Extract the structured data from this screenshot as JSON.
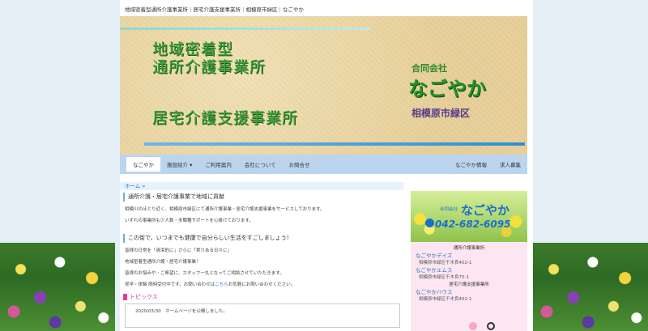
{
  "topbar": {
    "title": "地域密着型通所介護事業所｜居宅介護支援事業所｜相模原市緑区｜なごやか"
  },
  "hero": {
    "heading_line1": "地域密着型",
    "heading_line2": "通所介護事業所",
    "heading_line3": "居宅介護支援事業所",
    "company_type": "合同会社",
    "company_name": "なごやか",
    "area": "相模原市緑区"
  },
  "nav": {
    "items": [
      "なごやか",
      "施設紹介 ▾",
      "ご利用案内",
      "会社について",
      "お問合せ"
    ],
    "right_items": [
      "なごやか情報",
      "求人募集"
    ]
  },
  "breadcrumb": {
    "home": "ホーム »"
  },
  "main": {
    "section1_heading": "通所介護・居宅介護事業で地域に貢献",
    "section1_p1": "相模川のほとり近く、相模原市緑区にて通所介護事業・居宅介護支援事業をサービスしております。",
    "section1_p2": "いずれの事業所も少人数・多職種サポートを心掛けております。",
    "section2_heading": "この街で、いつまでも健康で自分らしい生活をすごしましょう！",
    "section2_p1": "皆様の日常を「清潔的に」さらに「実りある日々に」",
    "section2_p2": "地域密着型通所介護・居宅介護事業！",
    "section2_p3": "皆様のお悩みや・ご希望に、スタッフ一丸となってご相談させていただきます。",
    "section2_p4_prefix": "見学・体験 随時受付中です。お問い合わせは",
    "section2_p4_link": "こちら",
    "section2_p4_suffix": "お気軽にお問い合わせください。",
    "topics_heading": "トピックス",
    "topics_first": "2020/03/30　ホームページを公開しました。"
  },
  "sidebar": {
    "banner_company_type": "合同会社",
    "banner_company_name": "なごやか",
    "banner_phone": "042-682-6095",
    "cat1": "通所介護事業所",
    "office1_name": "なごやかデイズ",
    "office1_addr": "相模原市緑区千木良402-1",
    "office2_name": "なごやかエムス",
    "office2_addr": "相模原市緑区千木良75-1",
    "cat2": "居宅介護支援事業所",
    "office3_name": "なごやかハウス",
    "office3_addr": "相模原市緑区千木良402-1"
  }
}
